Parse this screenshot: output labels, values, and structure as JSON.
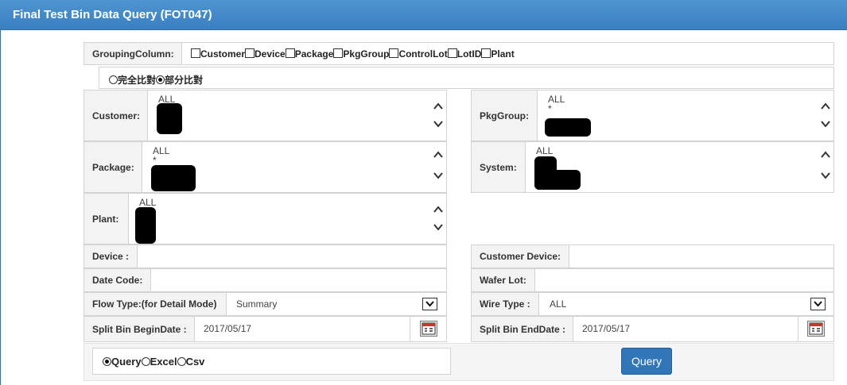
{
  "title": "Final Test Bin Data Query (FOT047)",
  "grouping": {
    "label": "GroupingColumn:",
    "options": [
      "Customer",
      "Device",
      "Package",
      "PkgGroup",
      "ControlLot",
      "LotID",
      "Plant"
    ]
  },
  "compare_mode": {
    "options": [
      "完全比對",
      "部分比對"
    ],
    "selected": "部分比對"
  },
  "customer": {
    "label": "Customer:",
    "items": [
      "ALL"
    ]
  },
  "pkggroup": {
    "label": "PkgGroup:",
    "items": [
      "ALL",
      "*"
    ]
  },
  "package": {
    "label": "Package:",
    "items": [
      "ALL",
      "*"
    ]
  },
  "system": {
    "label": "System:",
    "items": [
      "ALL"
    ]
  },
  "plant": {
    "label": "Plant:",
    "items": [
      "ALL"
    ]
  },
  "device": {
    "label": "Device :",
    "value": ""
  },
  "customer_device": {
    "label": "Customer Device:",
    "value": ""
  },
  "date_code": {
    "label": "Date Code:",
    "value": ""
  },
  "wafer_lot": {
    "label": "Wafer Lot:",
    "value": ""
  },
  "flow_type": {
    "label": "Flow Type:(for Detail Mode)",
    "value": "Summary"
  },
  "wire_type": {
    "label": "Wire Type :",
    "value": "ALL"
  },
  "split_begin": {
    "label": "Split Bin BeginDate :",
    "value": "2017/05/17"
  },
  "split_end": {
    "label": "Split Bin EndDate :",
    "value": "2017/05/17"
  },
  "output": {
    "options": [
      "Query",
      "Excel",
      "Csv"
    ],
    "selected": "Query"
  },
  "query_button": "Query",
  "icons": {
    "up": "chevron-up-icon",
    "down": "chevron-down-icon",
    "calendar": "calendar-icon"
  },
  "colors": {
    "header": "#3a7fc0",
    "button": "#3176b7"
  }
}
